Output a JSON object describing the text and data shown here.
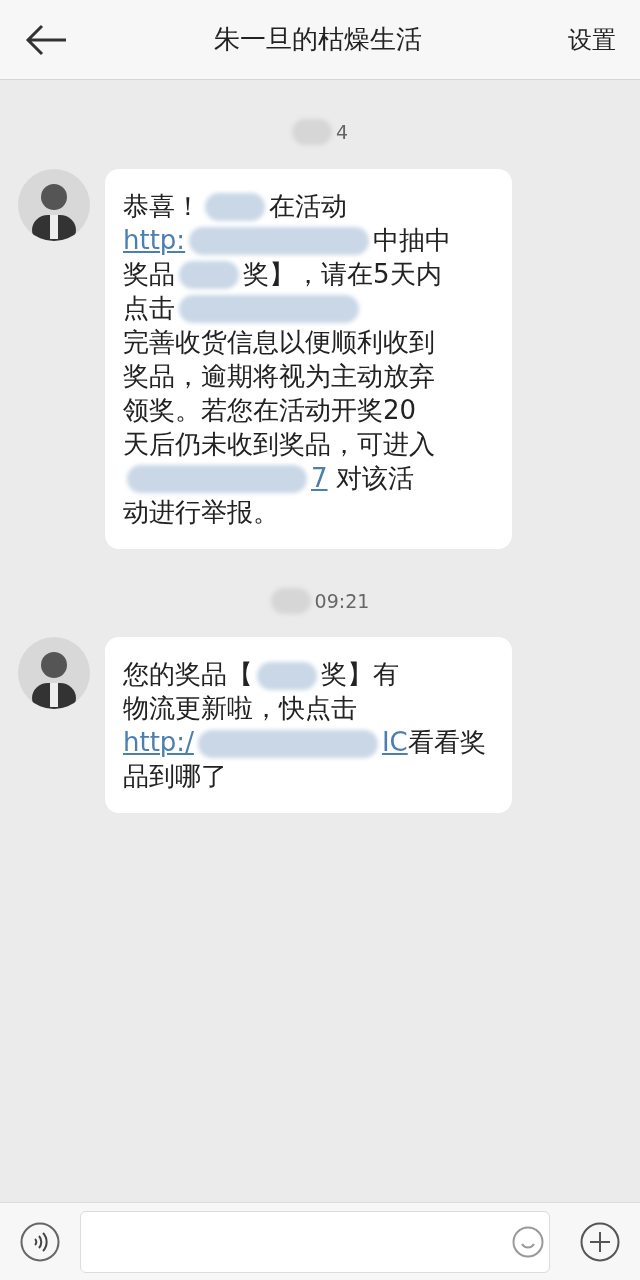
{
  "header": {
    "title": "朱一旦的枯燥生活",
    "action": "设置"
  },
  "messages": [
    {
      "time": "4",
      "lines": [
        [
          {
            "kind": "text",
            "text": "恭喜！"
          },
          {
            "kind": "redacted",
            "wide": false
          },
          {
            "kind": "text",
            "text": "在活动"
          }
        ],
        [
          {
            "kind": "link",
            "text": "http:"
          },
          {
            "kind": "redacted",
            "wide": true
          },
          {
            "kind": "text",
            "text": "中抽中"
          }
        ],
        [
          {
            "kind": "text",
            "text": "奖品"
          },
          {
            "kind": "redacted",
            "wide": false
          },
          {
            "kind": "text",
            "text": "奖】，请在5天内"
          }
        ],
        [
          {
            "kind": "text",
            "text": "点击"
          },
          {
            "kind": "redacted",
            "wide": true
          }
        ],
        [
          {
            "kind": "text",
            "text": "完善收货信息以便顺利收到"
          }
        ],
        [
          {
            "kind": "text",
            "text": "奖品，逾期将视为主动放弃"
          }
        ],
        [
          {
            "kind": "text",
            "text": "领奖。若您在活动开奖20"
          }
        ],
        [
          {
            "kind": "text",
            "text": "天后仍未收到奖品，可进入"
          }
        ],
        [
          {
            "kind": "redacted",
            "wide": true
          },
          {
            "kind": "link",
            "text": "7"
          },
          {
            "kind": "text",
            "text": " 对该活"
          }
        ],
        [
          {
            "kind": "text",
            "text": "动进行举报。"
          }
        ]
      ]
    },
    {
      "time": "09:21",
      "lines": [
        [
          {
            "kind": "text",
            "text": "您的奖品【"
          },
          {
            "kind": "redacted",
            "wide": false
          },
          {
            "kind": "text",
            "text": "奖】有"
          }
        ],
        [
          {
            "kind": "text",
            "text": "物流更新啦，快点击"
          }
        ],
        [
          {
            "kind": "link",
            "text": "http:/"
          },
          {
            "kind": "redacted",
            "wide": true
          },
          {
            "kind": "link",
            "text": "IC"
          },
          {
            "kind": "text",
            "text": "看看奖"
          }
        ],
        [
          {
            "kind": "text",
            "text": "品到哪了"
          }
        ]
      ]
    }
  ]
}
